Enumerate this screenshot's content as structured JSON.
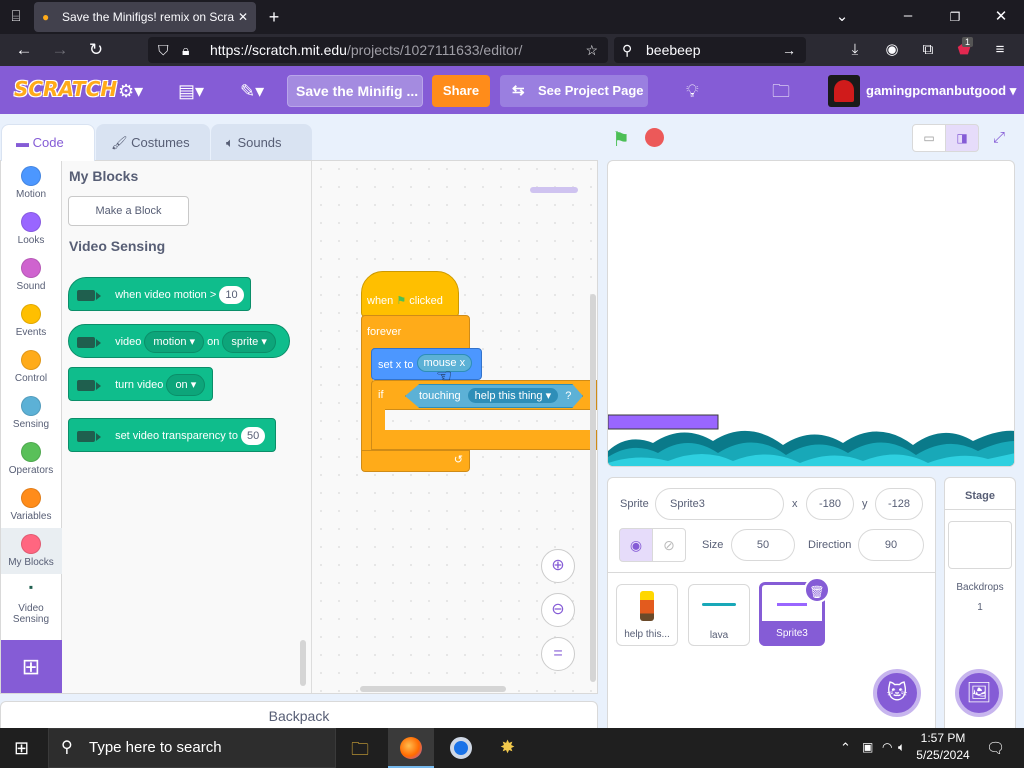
{
  "browser": {
    "tab_title": "Save the Minifigs! remix on Scra",
    "url_prefix": "https://scratch.mit.edu",
    "url_path": "/projects/1027111633/editor/",
    "search_text": "beebeep",
    "badge_count": "1"
  },
  "menu": {
    "logo": "SCRATCH",
    "project_title": "Save the Minifig ...",
    "share_label": "Share",
    "see_project_label": "See Project Page",
    "username": "gamingpcmanbutgood"
  },
  "tabs": {
    "code": "Code",
    "costumes": "Costumes",
    "sounds": "Sounds"
  },
  "categories": [
    {
      "label": "Motion",
      "color": "#4c97ff"
    },
    {
      "label": "Looks",
      "color": "#9966ff"
    },
    {
      "label": "Sound",
      "color": "#cf63cf"
    },
    {
      "label": "Events",
      "color": "#ffbf00"
    },
    {
      "label": "Control",
      "color": "#ffab19"
    },
    {
      "label": "Sensing",
      "color": "#5cb1d6"
    },
    {
      "label": "Operators",
      "color": "#59c059"
    },
    {
      "label": "Variables",
      "color": "#ff8c1a"
    },
    {
      "label": "My Blocks",
      "color": "#ff6680"
    },
    {
      "label": "Video Sensing",
      "color": "#0fbd8c"
    }
  ],
  "flyout": {
    "my_blocks_heading": "My Blocks",
    "make_block": "Make a Block",
    "video_heading": "Video Sensing",
    "b1_text": "when video motion >",
    "b1_value": "10",
    "b2_video": "video",
    "b2_motion": "motion",
    "b2_on": "on",
    "b2_sprite": "sprite",
    "b3_text": "turn video",
    "b3_value": "on",
    "b4_text": "set video transparency to",
    "b4_value": "50"
  },
  "script": {
    "hat_when": "when",
    "hat_clicked": "clicked",
    "forever": "forever",
    "setx": "set x to",
    "mousex": "mouse x",
    "if": "if",
    "touching": "touching",
    "touch_target": "help this thing",
    "question": "?"
  },
  "backpack": "Backpack",
  "sprite_info": {
    "sprite_label": "Sprite",
    "sprite_name": "Sprite3",
    "x_label": "x",
    "x_value": "-180",
    "y_label": "y",
    "y_value": "-128",
    "size_label": "Size",
    "size_value": "50",
    "direction_label": "Direction",
    "direction_value": "90"
  },
  "sprites": [
    {
      "name": "help this..."
    },
    {
      "name": "lava"
    },
    {
      "name": "Sprite3"
    }
  ],
  "stage_panel": {
    "title": "Stage",
    "backdrops_label": "Backdrops",
    "backdrops_count": "1"
  },
  "taskbar": {
    "search_placeholder": "Type here to search",
    "time": "1:57 PM",
    "date": "5/25/2024"
  }
}
